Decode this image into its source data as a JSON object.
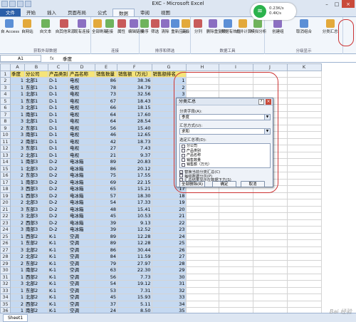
{
  "window": {
    "title": "EXC - Microsoft Excel"
  },
  "wifi": {
    "line1": "0.23K/s",
    "line2": "0.4K/s"
  },
  "tabs": [
    "文件",
    "开始",
    "插入",
    "页面布局",
    "公式",
    "数据",
    "审阅",
    "视图"
  ],
  "active_tab": "数据",
  "ribbon": {
    "groups": [
      {
        "label": "获取外部数据",
        "buttons": [
          "自 Access",
          "自网站",
          "自文本",
          "自其他来源",
          "现有连接"
        ]
      },
      {
        "label": "连接",
        "buttons": [
          "全部刷新",
          "连接",
          "属性",
          "编辑链接"
        ]
      },
      {
        "label": "排序和筛选",
        "buttons": [
          "排序",
          "筛选",
          "清除",
          "重新应用",
          "高级"
        ]
      },
      {
        "label": "数据工具",
        "buttons": [
          "分列",
          "删除重复项",
          "数据有效性",
          "合并计算",
          "模拟分析"
        ]
      },
      {
        "label": "分级显示",
        "buttons": [
          "创建组",
          "取消组合",
          "分类汇总"
        ]
      }
    ]
  },
  "formula": {
    "cell": "A1",
    "fx": "fx",
    "value": "季度"
  },
  "columns": [
    "A",
    "B",
    "C",
    "D",
    "E",
    "F",
    "G",
    "H",
    "I",
    "J",
    "K"
  ],
  "header_row": [
    "季度",
    "分公司",
    "产品类别",
    "产品名称",
    "销售数量",
    "销售额（万元）",
    "销售额排名"
  ],
  "rows": [
    [
      "1",
      "北部1",
      "D-1",
      "电视",
      "86",
      "38.36",
      "1"
    ],
    [
      "1",
      "东部1",
      "D-1",
      "电视",
      "78",
      "34.79",
      "2"
    ],
    [
      "1",
      "北部1",
      "D-1",
      "电视",
      "73",
      "32.56",
      "3"
    ],
    [
      "1",
      "东部1",
      "D-1",
      "电视",
      "67",
      "18.43",
      "4"
    ],
    [
      "3",
      "北部1",
      "D-1",
      "电视",
      "66",
      "18.15",
      "5"
    ],
    [
      "1",
      "南部1",
      "D-1",
      "电视",
      "64",
      "17.60",
      "6"
    ],
    [
      "3",
      "北部1",
      "D-1",
      "电视",
      "64",
      "28.54",
      "7"
    ],
    [
      "2",
      "东部1",
      "D-1",
      "电视",
      "56",
      "15.40",
      "8"
    ],
    [
      "3",
      "南部1",
      "D-1",
      "电视",
      "46",
      "12.65",
      "9"
    ],
    [
      "2",
      "南部1",
      "D-1",
      "电视",
      "42",
      "18.73",
      "10"
    ],
    [
      "3",
      "东部1",
      "D-1",
      "电视",
      "27",
      "7.43",
      "11"
    ],
    [
      "2",
      "北部1",
      "D-1",
      "电视",
      "21",
      "9.37",
      "12"
    ],
    [
      "1",
      "南部3",
      "D-2",
      "电冰箱",
      "89",
      "20.83",
      "13"
    ],
    [
      "1",
      "北部3",
      "D-2",
      "电冰箱",
      "86",
      "20.12",
      "14"
    ],
    [
      "2",
      "东部3",
      "D-2",
      "电冰箱",
      "75",
      "17.55",
      "15"
    ],
    [
      "1",
      "南部3",
      "D-2",
      "电冰箱",
      "69",
      "22.15",
      "16"
    ],
    [
      "3",
      "西部3",
      "D-2",
      "电冰箱",
      "65",
      "15.21",
      "17"
    ],
    [
      "1",
      "西部3",
      "D-2",
      "电冰箱",
      "57",
      "18.30",
      "18"
    ],
    [
      "2",
      "北部3",
      "D-2",
      "电冰箱",
      "54",
      "17.33",
      "19"
    ],
    [
      "3",
      "东部3",
      "D-2",
      "电冰箱",
      "48",
      "15.41",
      "20"
    ],
    [
      "3",
      "北部3",
      "D-2",
      "电冰箱",
      "45",
      "10.53",
      "21"
    ],
    [
      "2",
      "西部3",
      "D-2",
      "电冰箱",
      "39",
      "9.13",
      "22"
    ],
    [
      "3",
      "南部3",
      "D-2",
      "电冰箱",
      "39",
      "12.52",
      "23"
    ],
    [
      "1",
      "西部2",
      "K-1",
      "空调",
      "89",
      "12.28",
      "24"
    ],
    [
      "1",
      "东部2",
      "K-1",
      "空调",
      "89",
      "12.28",
      "25"
    ],
    [
      "3",
      "北部2",
      "K-1",
      "空调",
      "86",
      "30.44",
      "26"
    ],
    [
      "2",
      "北部2",
      "K-1",
      "空调",
      "84",
      "11.59",
      "27"
    ],
    [
      "2",
      "东部2",
      "K-1",
      "空调",
      "79",
      "27.97",
      "28"
    ],
    [
      "1",
      "南部2",
      "K-1",
      "空调",
      "63",
      "22.30",
      "29"
    ],
    [
      "1",
      "西部2",
      "K-1",
      "空调",
      "56",
      "7.73",
      "30"
    ],
    [
      "3",
      "北部2",
      "K-1",
      "空调",
      "54",
      "19.12",
      "31"
    ],
    [
      "1",
      "东部2",
      "K-1",
      "空调",
      "53",
      "7.31",
      "32"
    ],
    [
      "1",
      "北部2",
      "K-1",
      "空调",
      "45",
      "15.93",
      "33"
    ],
    [
      "2",
      "西部2",
      "K-1",
      "空调",
      "37",
      "5.11",
      "34"
    ],
    [
      "1",
      "南部2",
      "K-1",
      "空调",
      "24",
      "8.50",
      "35"
    ]
  ],
  "dialog": {
    "title": "分类汇总",
    "help": "?",
    "close": "×",
    "group_by_label": "分类字段(A):",
    "group_by_value": "季度",
    "func_label": "汇总方式(U):",
    "func_value": "求和",
    "items_label": "选定汇总项(D):",
    "items": [
      {
        "label": "分公司",
        "checked": false
      },
      {
        "label": "产品类别",
        "checked": false
      },
      {
        "label": "产品名称",
        "checked": false
      },
      {
        "label": "销售数量",
        "checked": false
      },
      {
        "label": "销售额（万元）",
        "checked": false
      },
      {
        "label": "销售额排名",
        "checked": true
      }
    ],
    "opt_replace": "替换当前分类汇总(C)",
    "opt_pagebreak": "每组数据分页(P)",
    "opt_below": "汇总结果显示在数据下方(S)",
    "btn_remove": "全部删除(R)",
    "btn_ok": "确定",
    "btn_cancel": "取消"
  },
  "sheet_tabs": [
    "Sheet1"
  ],
  "watermark": "Bai 经验"
}
